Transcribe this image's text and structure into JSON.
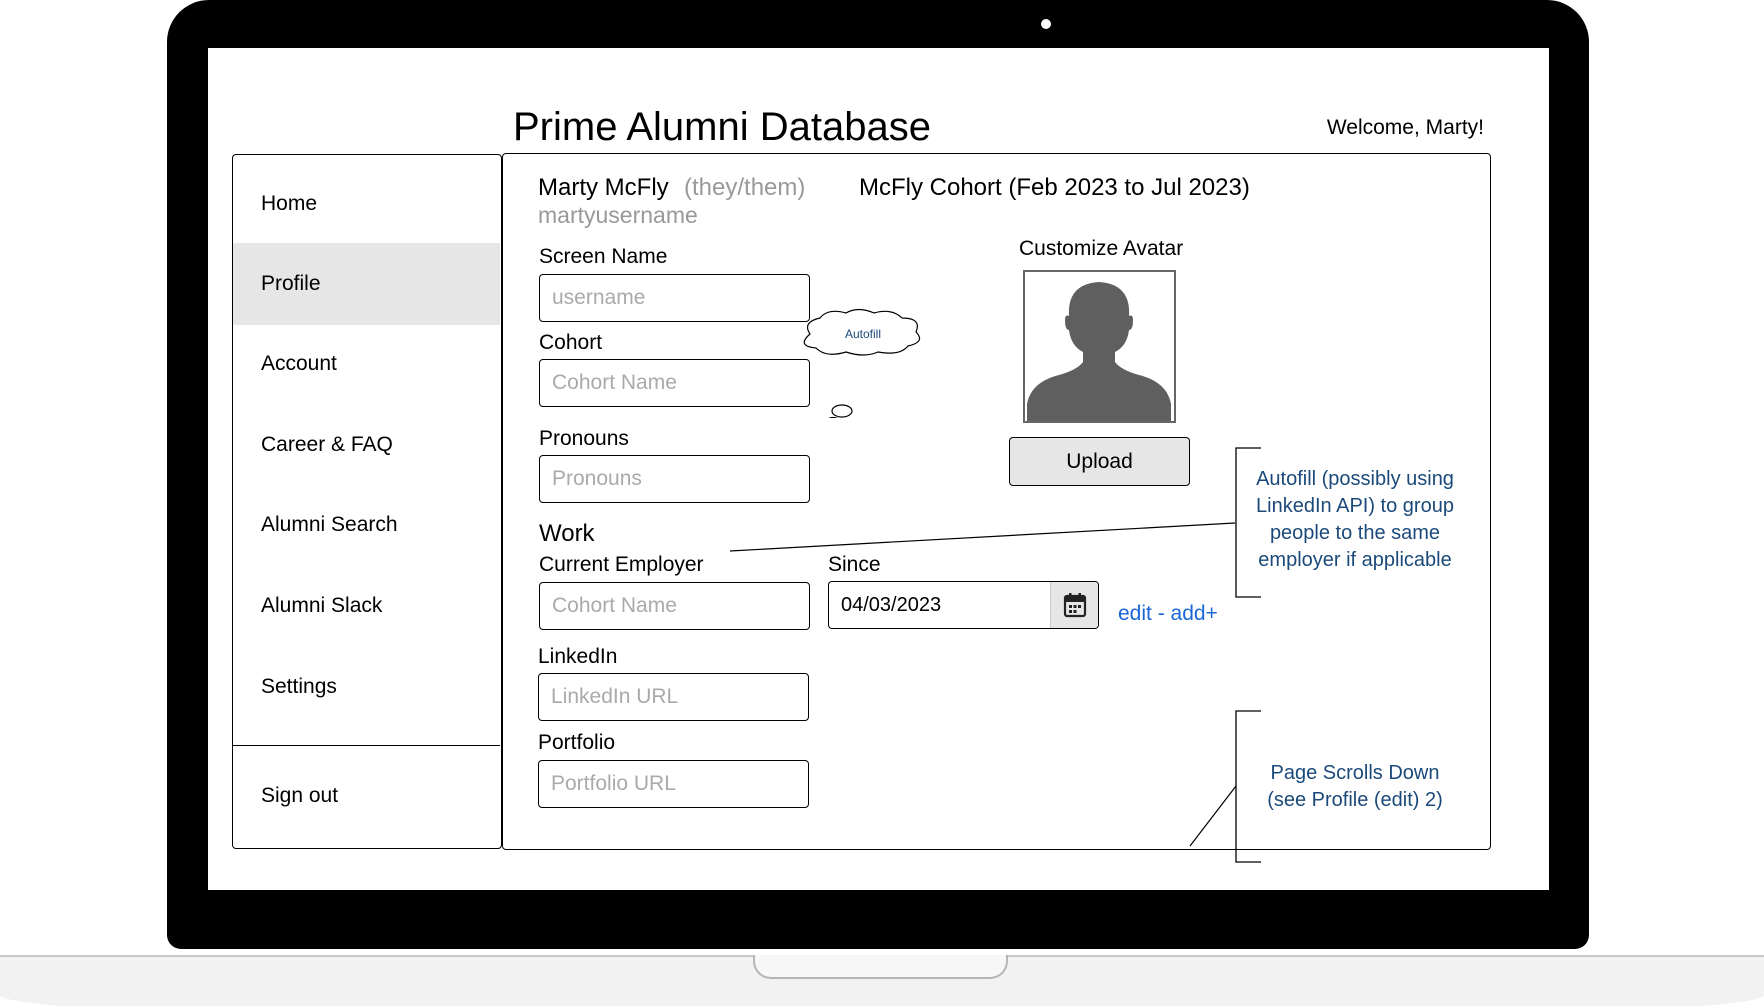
{
  "app": {
    "title": "Prime Alumni Database",
    "welcome": "Welcome, Marty!"
  },
  "sidebar": {
    "items": [
      {
        "label": "Home"
      },
      {
        "label": "Profile",
        "active": true
      },
      {
        "label": "Account"
      },
      {
        "label": "Career & FAQ"
      },
      {
        "label": "Alumni Search"
      },
      {
        "label": "Alumni Slack"
      },
      {
        "label": "Settings"
      }
    ],
    "sign_out": "Sign out"
  },
  "profile": {
    "name": "Marty McFly",
    "pronouns": "(they/them)",
    "username": "martyusername",
    "cohort": "McFly Cohort (Feb 2023 to Jul 2023)"
  },
  "form": {
    "screen_name": {
      "label": "Screen Name",
      "value": "",
      "placeholder": "username"
    },
    "cohort": {
      "label": "Cohort",
      "value": "",
      "placeholder": "Cohort Name"
    },
    "pronouns": {
      "label": "Pronouns",
      "value": "",
      "placeholder": "Pronouns"
    },
    "work_heading": "Work",
    "current_employer": {
      "label": "Current Employer",
      "value": "",
      "placeholder": "Cohort Name"
    },
    "since": {
      "label": "Since",
      "value": "04/03/2023"
    },
    "edit_add": "edit - add+",
    "linkedin": {
      "label": "LinkedIn",
      "value": "",
      "placeholder": "LinkedIn URL"
    },
    "portfolio": {
      "label": "Portfolio",
      "value": "",
      "placeholder": "Portfolio URL"
    }
  },
  "avatar": {
    "label": "Customize Avatar",
    "upload": "Upload",
    "icon": "person-silhouette-icon"
  },
  "annotations": {
    "autofill_bubble": "Autofill",
    "autofill_note": [
      "Autofill (possibly using",
      "LinkedIn API) to group",
      "people to the same",
      "employer if applicable"
    ],
    "scroll_note": [
      "Page Scrolls Down",
      "(see Profile (edit) 2)"
    ]
  },
  "colors": {
    "annotation": "#1b4a7a",
    "link": "#1a66d6",
    "placeholder": "#aaaaaa",
    "active_nav": "#e6e6e6"
  }
}
